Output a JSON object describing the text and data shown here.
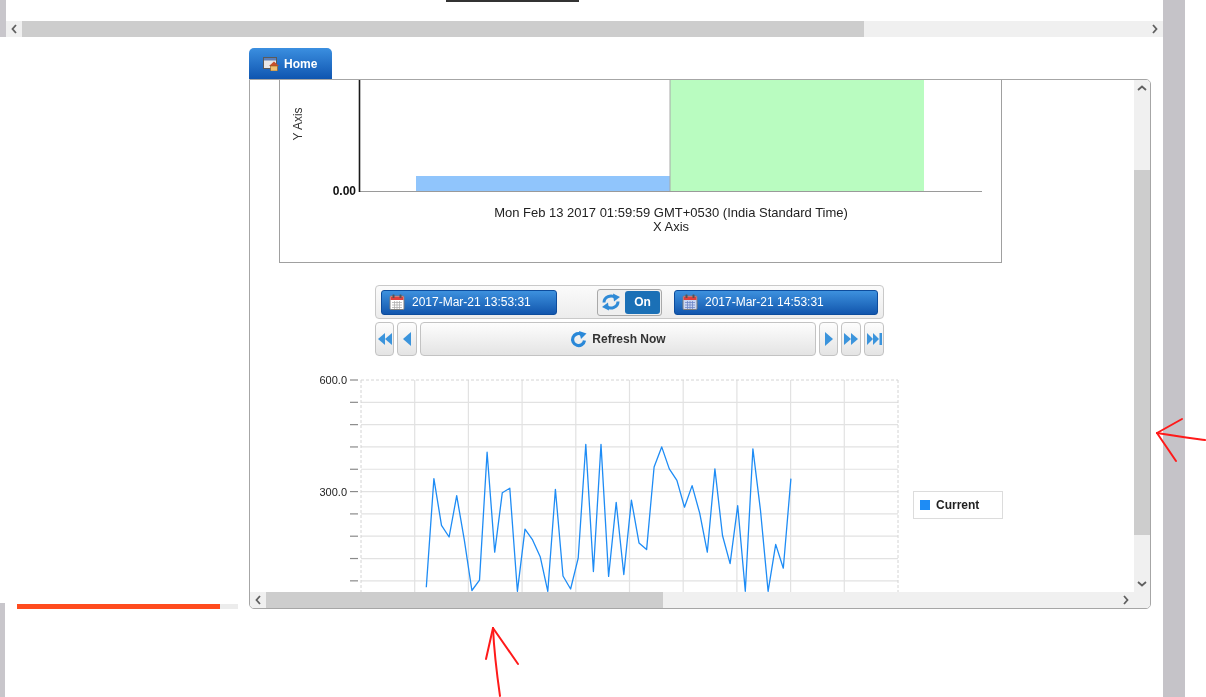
{
  "tabs": [
    {
      "label": "Home",
      "selected": true
    }
  ],
  "bar_chart": {
    "ylabel": "Y Axis",
    "y_tick": "0.00",
    "category": "Mon Feb 13 2017 01:59:59 GMT+0530 (India Standard Time)",
    "xlabel": "X Axis"
  },
  "time_range": {
    "start": "2017-Mar-21 13:53:31",
    "auto_refresh": {
      "label": "On",
      "on": true
    },
    "end": "2017-Mar-21 14:53:31"
  },
  "navigation": {
    "buttons": [
      {
        "kind": "rewind"
      },
      {
        "kind": "back"
      },
      {
        "kind": "refresh",
        "label": "Refresh Now"
      },
      {
        "kind": "forward"
      },
      {
        "kind": "fast_forward"
      },
      {
        "kind": "skip_to_end"
      }
    ]
  },
  "line_chart": {
    "chart_data": [
      {
        "type": "line",
        "ylim": [
          30,
          600
        ],
        "yticks": [
          {
            "value": 300,
            "label": "300.0"
          },
          {
            "value": 600,
            "label": "600.0"
          }
        ],
        "tick_labels": "y",
        "grid": true,
        "legend": "right",
        "series": [
          {
            "name": "Current",
            "color": "#1e8cf5",
            "values": [
              43,
              335,
              209,
              178,
              289,
              170,
              34,
              62,
              406,
              137,
              297,
              309,
              32,
              199,
              170,
              125,
              32,
              306,
              73,
              38,
              121,
              427,
              85,
              427,
              72,
              271,
              77,
              277,
              162,
              144,
              366,
              420,
              361,
              330,
              258,
              316,
              242,
              137,
              361,
              182,
              106,
              262,
              32,
              415,
              249,
              32,
              158,
              94,
              335
            ]
          }
        ]
      }
    ]
  },
  "progress": {
    "level": 0.92
  }
}
